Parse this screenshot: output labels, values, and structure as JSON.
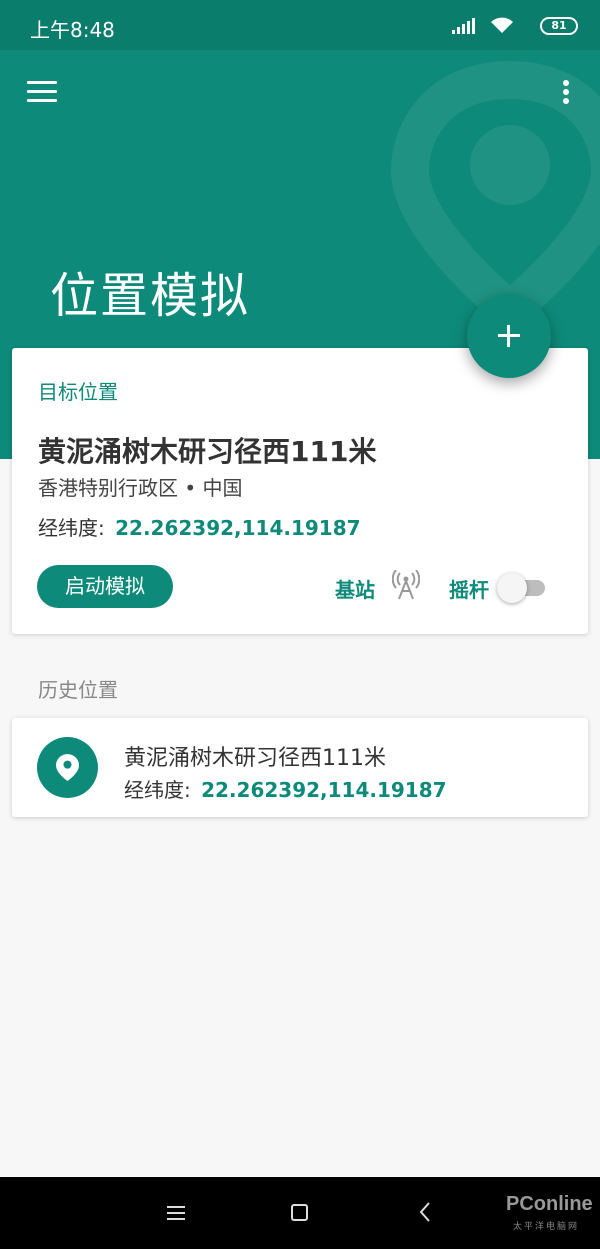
{
  "status_bar": {
    "time": "上午8:48",
    "battery": "81"
  },
  "header": {
    "title": "位置模拟"
  },
  "target_card": {
    "section_label": "目标位置",
    "place_name": "黄泥涌树木研习径西111米",
    "region": "香港特别行政区 • 中国",
    "coord_label": "经纬度:",
    "coord_value": "22.262392,114.19187",
    "start_button": "启动模拟",
    "base_station_label": "基站",
    "joystick_label": "摇杆",
    "joystick_enabled": false
  },
  "history": {
    "header": "历史位置",
    "items": [
      {
        "name": "黄泥涌树木研习径西111米",
        "coord_label": "经纬度:",
        "coord_value": "22.262392,114.19187"
      }
    ]
  },
  "nav_bar": {
    "brand": "PConline",
    "brand_sub": "太平洋电脑网"
  },
  "icons": {
    "menu": "hamburger-icon",
    "more": "more-vert-icon",
    "fab": "add-icon",
    "antenna": "antenna-icon",
    "history_item": "location-pin-icon"
  },
  "colors": {
    "primary": "#0e8a7a",
    "status_bar": "#0b7d6d",
    "background": "#f7f7f7"
  }
}
